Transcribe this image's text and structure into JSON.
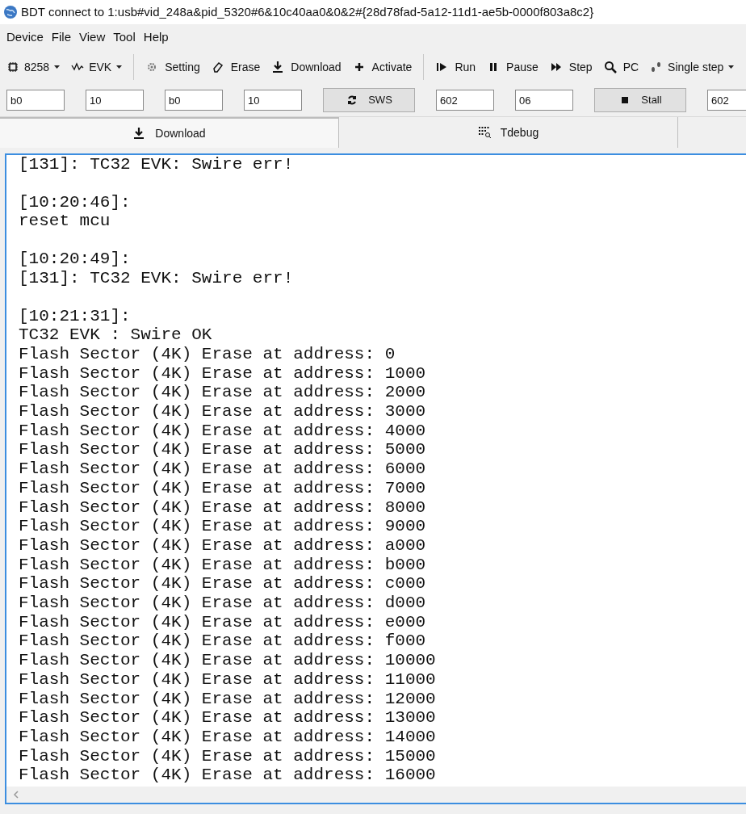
{
  "window": {
    "title": "BDT connect to 1:usb#vid_248a&pid_5320#6&10c40aa0&0&2#{28d78fad-5a12-11d1-ae5b-0000f803a8c2}"
  },
  "menu": [
    "Device",
    "File",
    "View",
    "Tool",
    "Help"
  ],
  "toolbar": [
    {
      "kind": "dropdown",
      "label": "8258"
    },
    {
      "kind": "dropdown",
      "label": "EVK"
    },
    {
      "kind": "separator"
    },
    {
      "kind": "button",
      "label": "Setting"
    },
    {
      "kind": "button",
      "label": "Erase"
    },
    {
      "kind": "button",
      "label": "Download"
    },
    {
      "kind": "button",
      "label": "Activate"
    },
    {
      "kind": "separator"
    },
    {
      "kind": "button",
      "label": "Run"
    },
    {
      "kind": "button",
      "label": "Pause"
    },
    {
      "kind": "button",
      "label": "Step"
    },
    {
      "kind": "button",
      "label": "PC"
    },
    {
      "kind": "dropdown",
      "label": "Single step"
    }
  ],
  "fields": [
    {
      "kind": "input",
      "value": "b0"
    },
    {
      "kind": "input",
      "value": "10"
    },
    {
      "kind": "input",
      "value": "b0"
    },
    {
      "kind": "input",
      "value": "10"
    },
    {
      "kind": "button",
      "label": "SWS"
    },
    {
      "kind": "input",
      "value": "602"
    },
    {
      "kind": "input",
      "value": "06"
    },
    {
      "kind": "button",
      "label": "Stall"
    },
    {
      "kind": "input",
      "value": "602"
    }
  ],
  "tabs": [
    {
      "label": "Download",
      "selected": true
    },
    {
      "label": "Tdebug",
      "selected": false
    }
  ],
  "log": [
    [
      "[131]: TC32 EVK: Swire err!"
    ],
    [
      "[10:20:46]:",
      "reset mcu"
    ],
    [
      "[10:20:49]:",
      "[131]: TC32 EVK: Swire err!"
    ],
    [
      "[10:21:31]:",
      "TC32 EVK : Swire OK",
      "Flash Sector (4K) Erase at address: 0",
      "Flash Sector (4K) Erase at address: 1000",
      "Flash Sector (4K) Erase at address: 2000",
      "Flash Sector (4K) Erase at address: 3000",
      "Flash Sector (4K) Erase at address: 4000",
      "Flash Sector (4K) Erase at address: 5000",
      "Flash Sector (4K) Erase at address: 6000",
      "Flash Sector (4K) Erase at address: 7000",
      "Flash Sector (4K) Erase at address: 8000",
      "Flash Sector (4K) Erase at address: 9000",
      "Flash Sector (4K) Erase at address: a000",
      "Flash Sector (4K) Erase at address: b000",
      "Flash Sector (4K) Erase at address: c000",
      "Flash Sector (4K) Erase at address: d000",
      "Flash Sector (4K) Erase at address: e000",
      "Flash Sector (4K) Erase at address: f000",
      "Flash Sector (4K) Erase at address: 10000",
      "Flash Sector (4K) Erase at address: 11000",
      "Flash Sector (4K) Erase at address: 12000",
      "Flash Sector (4K) Erase at address: 13000",
      "Flash Sector (4K) Erase at address: 14000",
      "Flash Sector (4K) Erase at address: 15000",
      "Flash Sector (4K) Erase at address: 16000"
    ]
  ]
}
